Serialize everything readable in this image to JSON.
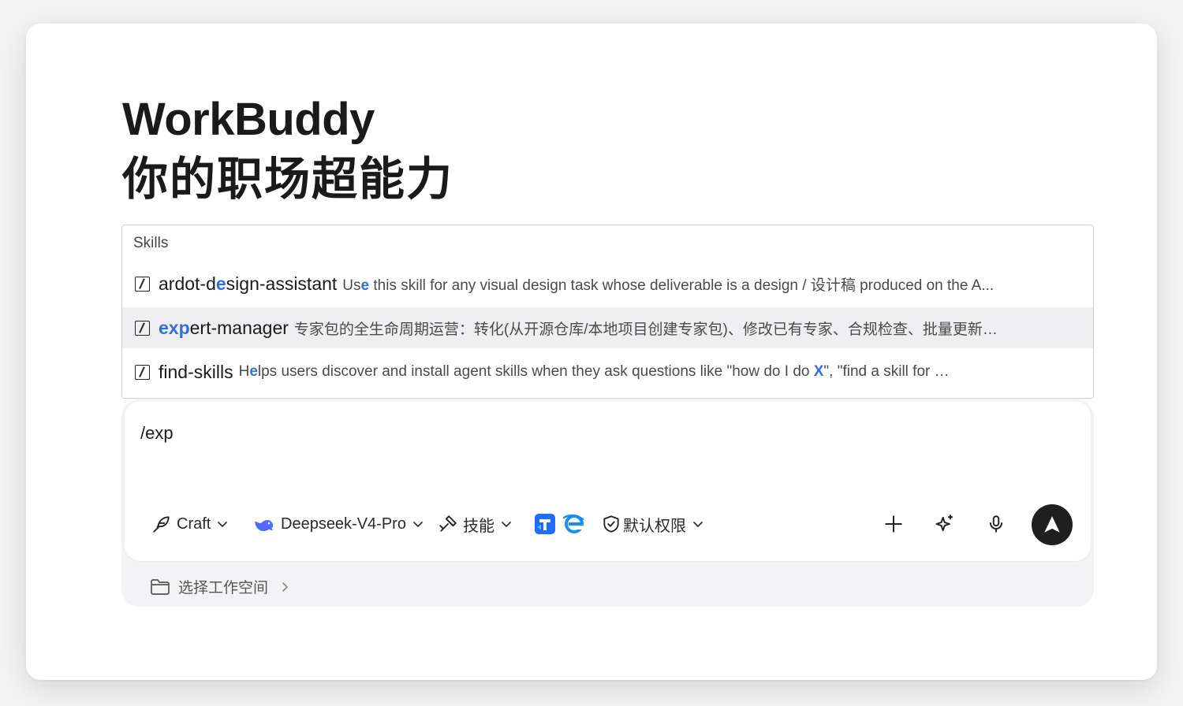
{
  "hero": {
    "title": "WorkBuddy",
    "subtitle": "你的职场超能力"
  },
  "skills": {
    "header": "Skills",
    "items": [
      {
        "name_pre": "ardot-d",
        "name_hl": "e",
        "name_post": "sign-assistant",
        "desc_pre": "Us",
        "desc_hl": "e",
        "desc_post": " this skill for any visual design task whose deliverable is a design / 设计稿 produced on the A..."
      },
      {
        "name_pre": "",
        "name_hl": "exp",
        "name_post": "ert-manager",
        "desc_pre": "专家包的全生命周期运营：转化(从开源仓库/本地项目创建专家包)、修改已有专家、合规检查、批量更新、质量审...",
        "desc_hl": "",
        "desc_post": ""
      },
      {
        "name_pre": "find-skills",
        "name_hl": "",
        "name_post": "",
        "desc_pre": "H",
        "desc_hl": "e",
        "desc_post": "lps users discover and install agent skills when they ask questions like \"how do I do ",
        "desc_hl2": "X",
        "desc_post2": "\", \"find a skill for X\", \"i..."
      }
    ]
  },
  "composer": {
    "input_value": "/exp",
    "toolbar": {
      "mode_label": "Craft",
      "model_label": "Deepseek-V4-Pro",
      "skills_label": "技能",
      "permission_label": "默认权限"
    },
    "workspace_label": "选择工作空间"
  },
  "colors": {
    "accent": "#2f6fe0",
    "send_button": "#1f1f1f",
    "highlight_row": "#efeff1"
  },
  "icons": [
    "slash-command-icon",
    "feather-icon",
    "deepseek-whale-icon",
    "chevron-down-icon",
    "skills-icon",
    "tencent-docs-icon",
    "ie-icon",
    "shield-check-icon",
    "plus-icon",
    "sparkle-icon",
    "microphone-icon",
    "send-arrow-icon",
    "folder-icon",
    "chevron-right-icon"
  ]
}
